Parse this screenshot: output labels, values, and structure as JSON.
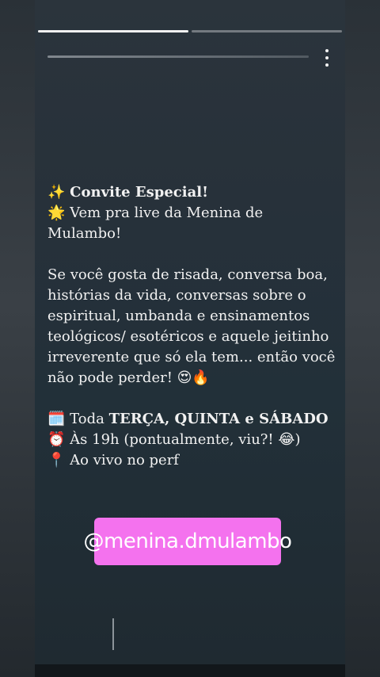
{
  "story": {
    "progress": [
      1.0,
      0.0
    ],
    "lines": {
      "l1_icon": "✨",
      "l1_text": "Convite Especial!",
      "l2_icon": "🌟",
      "l2_text": "Vem pra live da Menina de",
      "l3_text": "Mulambo!",
      "p1": "Se você gosta de risada, conversa boa,",
      "p2": "histórias da vida, conversas sobre o",
      "p3": "espiritual, umbanda e ensinamentos",
      "p4": "teológicos/ esotéricos e aquele jeitinho",
      "p5": "irreverente que só ela tem... então você",
      "p6": "não pode perder!",
      "p6_emoji": "😍🔥",
      "s1_icon": "🗓️",
      "s1_prefix": "Toda",
      "s1_bold": "TERÇA, QUINTA e SÁBADO",
      "s2_icon": "⏰",
      "s2_text": "Às 19h (pontualmente, viu?!",
      "s2_emoji": "😂",
      "s2_close": ")",
      "s3_icon": "📍",
      "s3_text": "Ao vivo no perf"
    },
    "handle": "@menina.dmulambo"
  },
  "icons": {
    "menu": "more-vertical-icon"
  },
  "colors": {
    "handle_bg": "#f472ee",
    "text": "#f1f1f1"
  }
}
